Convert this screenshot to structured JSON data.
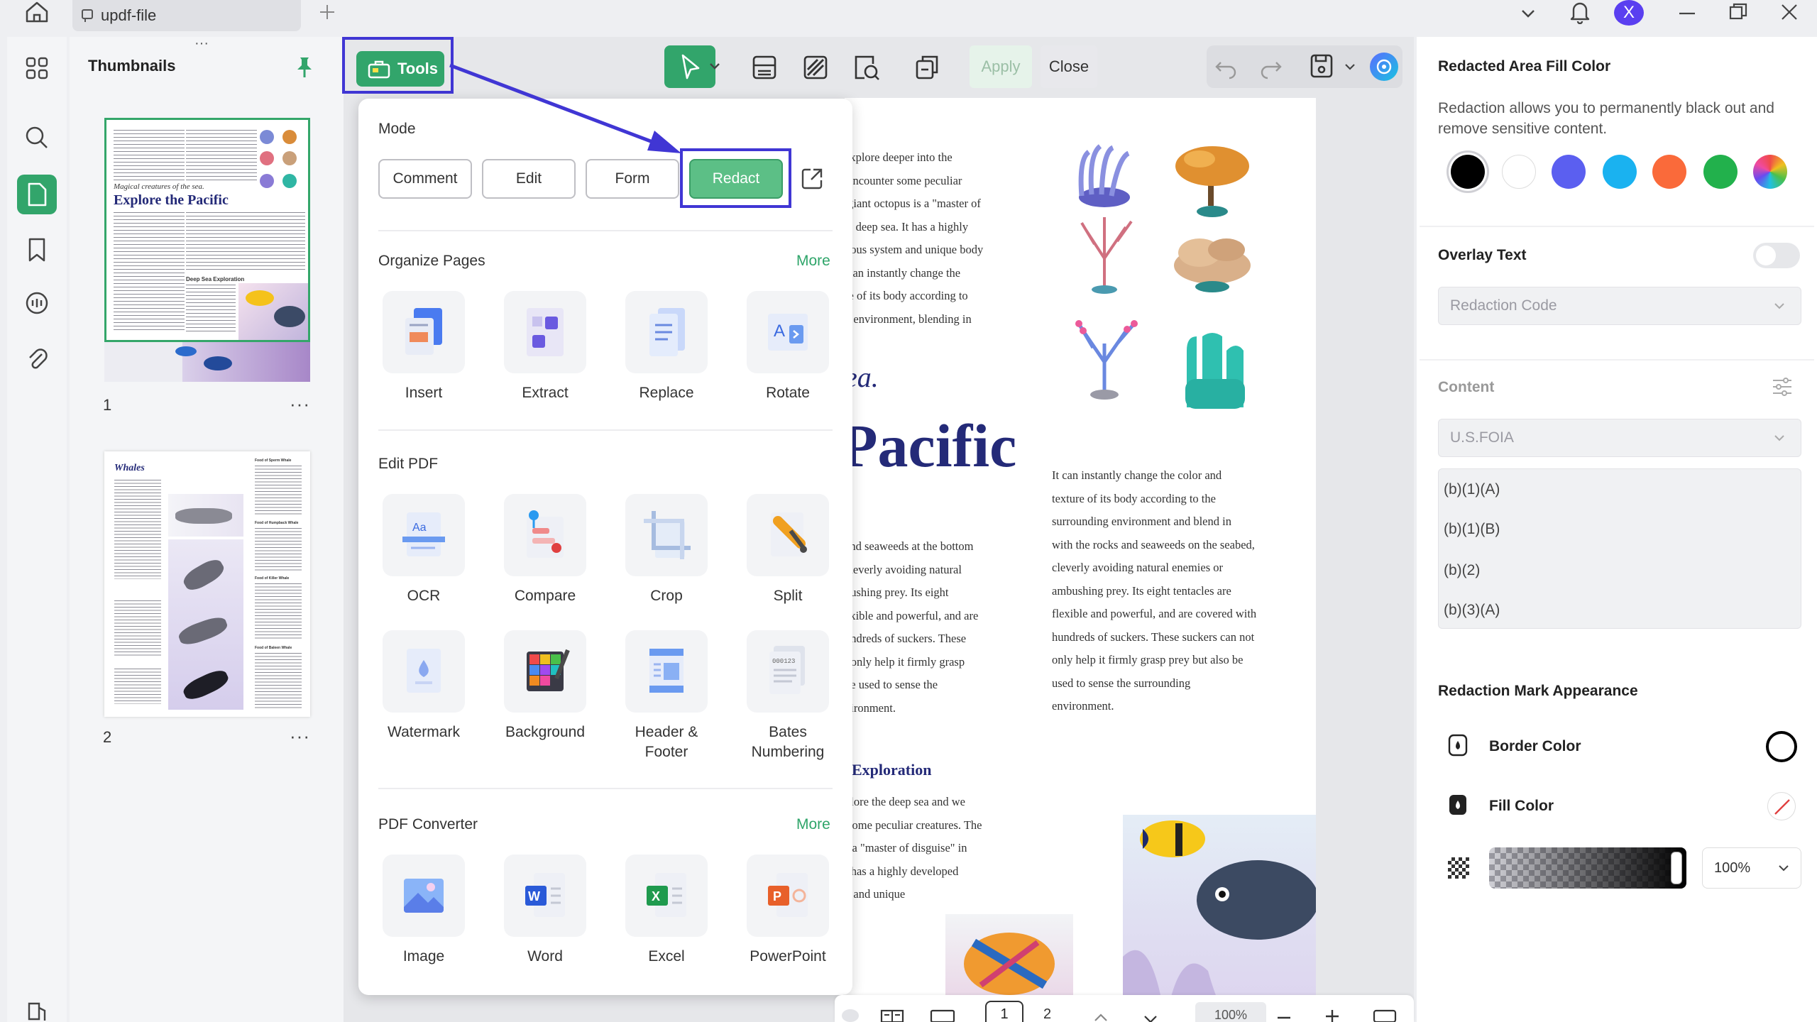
{
  "window": {
    "tab_title": "updf-file"
  },
  "thumbnails": {
    "title": "Thumbnails",
    "pages": [
      {
        "number": "1"
      },
      {
        "number": "2"
      }
    ],
    "more_dots": "···"
  },
  "thumb1": {
    "heading_small": "Magical creatures of the sea.",
    "heading_big": "Explore the Pacific",
    "section": "Deep Sea Exploration"
  },
  "thumb2": {
    "title": "Whales",
    "col2_head": "Food of Sperm Whale",
    "col2_head2": "Food of Humpback Whale",
    "col2_head3": "Food of Killer Whale",
    "col2_head4": "Food of Baleen Whale"
  },
  "tools": {
    "label": "Tools"
  },
  "toolbar": {
    "apply": "Apply",
    "close": "Close"
  },
  "popup": {
    "mode_label": "Mode",
    "modes": [
      "Comment",
      "Edit",
      "Form",
      "Redact"
    ],
    "organize": {
      "title": "Organize Pages",
      "more": "More",
      "items": [
        "Insert",
        "Extract",
        "Replace",
        "Rotate"
      ]
    },
    "editpdf": {
      "title": "Edit PDF",
      "items": [
        "OCR",
        "Compare",
        "Crop",
        "Split",
        "Watermark",
        "Background",
        "Header &\nFooter",
        "Bates\nNumbering"
      ]
    },
    "converter": {
      "title": "PDF Converter",
      "more": "More",
      "items": [
        "Image",
        "Word",
        "Excel",
        "PowerPoint"
      ]
    }
  },
  "doc": {
    "col_a": "explore deeper into the\n encounter some peculiar\n giant octopus is a \"master of\n e deep sea. It has a highly\nvous system and unique body\n can instantly change the\nre of its body according to\ng environment, blending in",
    "big_small": "ea.",
    "big_title": "Pacific",
    "col_b": "and seaweeds at the bottom\ncleverly avoiding natural\nbushing prey. Its eight\nexible and powerful, and are\nundreds of suckers. These\nt only help it firmly grasp\nbe used to sense the\nvironment.",
    "col_c": "It can instantly change the color and\ntexture of its body according to the\nsurrounding environment and blend in\nwith the rocks and seaweeds on the seabed,\ncleverly avoiding natural enemies or\nambushing prey. Its eight tentacles are\nflexible and powerful, and are covered with\nhundreds of suckers. These suckers can not\nonly help it firmly grasp prey but also be\nused to sense the surrounding\nenvironment.",
    "section": "Exploration",
    "col_d": "plore the deep sea and we\n some peculiar creatures. The\ns a \"master of disguise\" in\nt has a highly developed\nn and unique\n."
  },
  "right": {
    "fill_title": "Redacted Area Fill Color",
    "fill_desc": "Redaction allows you to permanently black out and remove sensitive content.",
    "colors": [
      "#000000",
      "#ffffff",
      "#5b5ff0",
      "#1ab2f0",
      "#fa6a3a",
      "#22b14c"
    ],
    "overlay_title": "Overlay Text",
    "overlay_placeholder": "Redaction Code",
    "content_title": "Content",
    "content_select": "U.S.FOIA",
    "codes": [
      "(b)(1)(A)",
      "(b)(1)(B)",
      "(b)(2)",
      "(b)(3)(A)"
    ],
    "appearance_title": "Redaction Mark Appearance",
    "border_label": "Border Color",
    "fill_label": "Fill Color",
    "opacity": "100%"
  },
  "bottom": {
    "pages": [
      "1",
      "2"
    ],
    "zoom": "100%"
  },
  "accent": "#32a56b",
  "highlight": "#4036d4"
}
